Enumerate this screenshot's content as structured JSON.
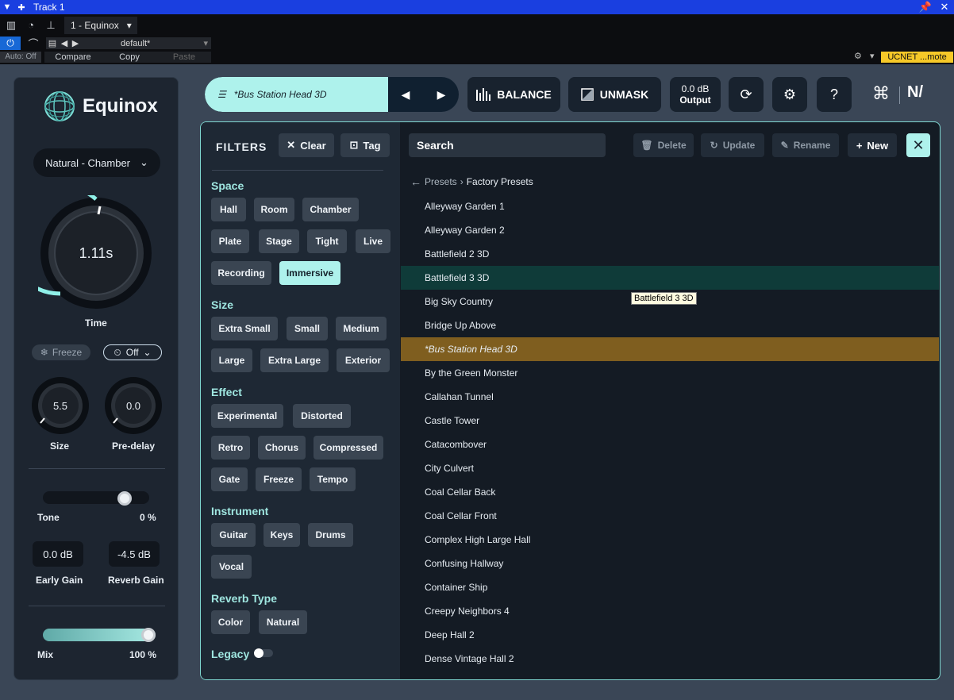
{
  "host": {
    "window_title": "Track 1",
    "track_select": "1 - Equinox",
    "preset": "default*",
    "auto": "Auto: Off",
    "compare": "Compare",
    "copy": "Copy",
    "paste": "Paste",
    "badge": "UCNET ...mote"
  },
  "plugin": {
    "name": "Equinox",
    "mode": "Natural - Chamber",
    "time": {
      "value": "1.11s",
      "label": "Time"
    },
    "freeze": "Freeze",
    "duck": "Off",
    "size": {
      "value": "5.5",
      "label": "Size"
    },
    "predelay": {
      "value": "0.0",
      "label": "Pre-delay"
    },
    "tone": {
      "label": "Tone",
      "value": "0 %",
      "position": 0.5
    },
    "early_gain": {
      "value": "0.0 dB",
      "label": "Early Gain"
    },
    "reverb_gain": {
      "value": "-4.5 dB",
      "label": "Reverb Gain"
    },
    "mix": {
      "label": "Mix",
      "value": "100 %",
      "fraction": 1.0
    }
  },
  "topbar": {
    "preset_name": "*Bus Station Head 3D",
    "balance": "BALANCE",
    "unmask": "UNMASK",
    "output_value": "0.0 dB",
    "output_label": "Output"
  },
  "filters": {
    "title": "FILTERS",
    "clear": "Clear",
    "tag": "Tag",
    "sections": {
      "space": {
        "title": "Space",
        "chips": [
          "Hall",
          "Room",
          "Chamber",
          "Plate",
          "Stage",
          "Tight",
          "Live",
          "Recording",
          "Immersive"
        ]
      },
      "size": {
        "title": "Size",
        "chips": [
          "Extra Small",
          "Small",
          "Medium",
          "Large",
          "Extra Large",
          "Exterior"
        ]
      },
      "effect": {
        "title": "Effect",
        "chips": [
          "Experimental",
          "Distorted",
          "Retro",
          "Chorus",
          "Compressed",
          "Gate",
          "Freeze",
          "Tempo"
        ]
      },
      "instrument": {
        "title": "Instrument",
        "chips": [
          "Guitar",
          "Keys",
          "Drums",
          "Vocal"
        ]
      },
      "reverb_type": {
        "title": "Reverb Type",
        "chips": [
          "Color",
          "Natural"
        ]
      }
    },
    "legacy": "Legacy"
  },
  "browser": {
    "search": "Search",
    "delete": "Delete",
    "update": "Update",
    "rename": "Rename",
    "new": "New",
    "crumb_root": "Presets",
    "crumb_current": "Factory Presets",
    "tooltip": "Battlefield 3 3D",
    "presets": [
      "Alleyway Garden 1",
      "Alleyway Garden 2",
      "Battlefield 2 3D",
      "Battlefield 3 3D",
      "Big Sky Country",
      "Bridge Up Above",
      "*Bus Station Head 3D",
      "By the Green Monster",
      "Callahan Tunnel",
      "Castle Tower",
      "Catacombover",
      "City Culvert",
      "Coal Cellar Back",
      "Coal Cellar Front",
      "Complex High Large Hall",
      "Confusing Hallway",
      "Container Ship",
      "Creepy Neighbors 4",
      "Deep Hall 2",
      "Dense Vintage Hall 2"
    ]
  },
  "colors": {
    "accent": "#aef2ec",
    "selected_row": "#0f3b39",
    "current_row": "#7f5e1f",
    "host_title": "#1a3fe0"
  }
}
